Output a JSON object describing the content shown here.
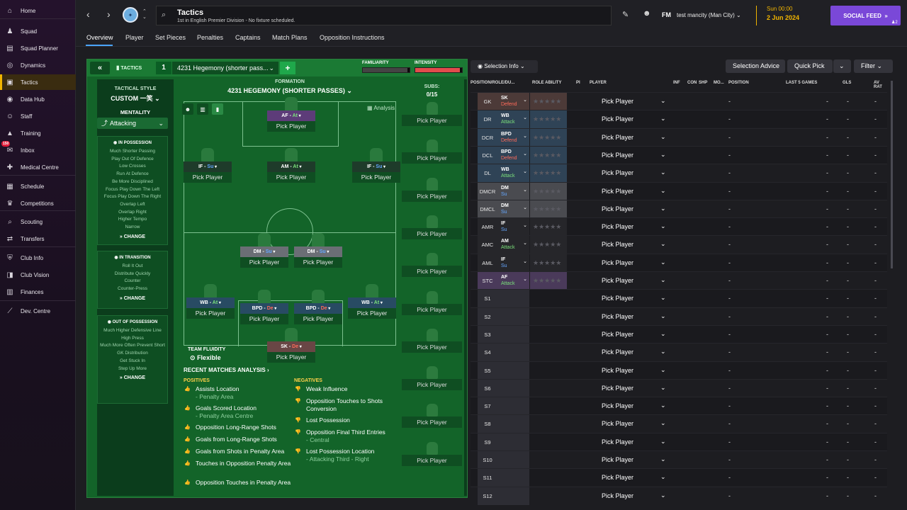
{
  "sidebar": {
    "items": [
      {
        "label": "Home",
        "icon": "home-icon",
        "glyph": "⌂"
      },
      {
        "label": "Squad",
        "icon": "squad-icon",
        "glyph": "♟"
      },
      {
        "label": "Squad Planner",
        "icon": "squad-planner-icon",
        "glyph": "▤"
      },
      {
        "label": "Dynamics",
        "icon": "dynamics-icon",
        "glyph": "◎"
      },
      {
        "label": "Tactics",
        "icon": "tactics-icon",
        "glyph": "▣",
        "active": true
      },
      {
        "label": "Data Hub",
        "icon": "data-hub-icon",
        "glyph": "◉"
      },
      {
        "label": "Staff",
        "icon": "staff-icon",
        "glyph": "☺"
      },
      {
        "label": "Training",
        "icon": "training-icon",
        "glyph": "▲"
      },
      {
        "label": "Inbox",
        "icon": "inbox-icon",
        "glyph": "✉",
        "badge": "150"
      },
      {
        "label": "Medical Centre",
        "icon": "medical-icon",
        "glyph": "✚"
      },
      {
        "label": "Schedule",
        "icon": "schedule-icon",
        "glyph": "▦"
      },
      {
        "label": "Competitions",
        "icon": "trophy-icon",
        "glyph": "♛"
      },
      {
        "label": "Scouting",
        "icon": "scouting-icon",
        "glyph": "⌕"
      },
      {
        "label": "Transfers",
        "icon": "transfers-icon",
        "glyph": "⇄"
      },
      {
        "label": "Club Info",
        "icon": "club-info-icon",
        "glyph": "⛨"
      },
      {
        "label": "Club Vision",
        "icon": "club-vision-icon",
        "glyph": "◨"
      },
      {
        "label": "Finances",
        "icon": "finances-icon",
        "glyph": "▥"
      },
      {
        "label": "Dev. Centre",
        "icon": "dev-centre-icon",
        "glyph": "⟋"
      }
    ]
  },
  "topbar": {
    "title": "Tactics",
    "subtitle": "1st in English Premier Division - No fixture scheduled.",
    "fm_label": "FM",
    "manager": "test mancity (Man City)",
    "time": "Sun 00:00",
    "date": "2 Jun 2024",
    "social_feed": "SOCIAL FEED",
    "social_count": "2"
  },
  "tabs": [
    "Overview",
    "Player",
    "Set Pieces",
    "Penalties",
    "Captains",
    "Match Plans",
    "Opposition Instructions"
  ],
  "tactics": {
    "header_label": "TACTICS",
    "slot_number": "1",
    "slot_name": "4231 Hegemony (shorter pass...",
    "familiarity_label": "FAMILIARITY",
    "familiarity_value": 0.95,
    "intensity_label": "INTENSITY",
    "intensity_value": 0.95,
    "tactical_style_label": "TACTICAL STYLE",
    "tactical_style_value": "CUSTOM 一笑",
    "mentality_label": "MENTALITY",
    "mentality_value": "Attacking",
    "formation_label": "FORMATION",
    "formation_name": "4231 HEGEMONY (SHORTER PASSES)",
    "analysis_label": "Analysis",
    "subs_label": "SUBS:",
    "subs_count": "0/15",
    "team_fluidity_label": "TEAM FLUIDITY",
    "team_fluidity_value": "Flexible",
    "in_possession": {
      "title": "IN POSSESSION",
      "items": [
        "Much Shorter Passing",
        "Play Out Of Defence",
        "Low Crosses",
        "Run At Defence",
        "Be More Disciplined",
        "Focus Play Down The Left",
        "Focus Play Down The Right",
        "Overlap Left",
        "Overlap Right",
        "Higher Tempo",
        "Narrow"
      ],
      "change": "CHANGE"
    },
    "in_transition": {
      "title": "IN TRANSITION",
      "items": [
        "Roll It Out",
        "Distribute Quickly",
        "Counter",
        "Counter-Press"
      ],
      "change": "CHANGE"
    },
    "out_of_possession": {
      "title": "OUT OF POSSESSION",
      "items": [
        "Much Higher Defensive Line",
        "High Press",
        "Much More Often Prevent Short GK Distribution",
        "Get Stuck In",
        "Step Up More"
      ],
      "change": "CHANGE"
    },
    "positions": [
      {
        "pos": "AF",
        "duty": "At",
        "cls": "fw",
        "player": "Pick Player"
      },
      {
        "pos": "IF",
        "duty": "Su",
        "cls": "mid",
        "player": "Pick Player"
      },
      {
        "pos": "AM",
        "duty": "At",
        "cls": "mid",
        "player": "Pick Player"
      },
      {
        "pos": "IF",
        "duty": "Su",
        "cls": "mid",
        "player": "Pick Player"
      },
      {
        "pos": "DM",
        "duty": "Su",
        "cls": "dm",
        "player": "Pick Player"
      },
      {
        "pos": "DM",
        "duty": "Su",
        "cls": "dm",
        "player": "Pick Player"
      },
      {
        "pos": "WB",
        "duty": "At",
        "cls": "df",
        "player": "Pick Player"
      },
      {
        "pos": "BPD",
        "duty": "De",
        "cls": "df",
        "player": "Pick Player"
      },
      {
        "pos": "BPD",
        "duty": "De",
        "cls": "df",
        "player": "Pick Player"
      },
      {
        "pos": "WB",
        "duty": "At",
        "cls": "df",
        "player": "Pick Player"
      },
      {
        "pos": "SK",
        "duty": "De",
        "cls": "gk",
        "player": "Pick Player"
      }
    ],
    "sub_slot_label": "Pick Player",
    "recent": {
      "title": "RECENT MATCHES ANALYSIS",
      "positives_label": "POSITIVES",
      "negatives_label": "NEGATIVES",
      "positives": [
        {
          "text": "Assists Location",
          "sub": "- Penalty Area"
        },
        {
          "text": "Goals Scored Location",
          "sub": "- Penalty Area Centre"
        },
        {
          "text": "Opposition Long-Range Shots",
          "sub": ""
        },
        {
          "text": "Goals from Long-Range Shots",
          "sub": ""
        },
        {
          "text": "Goals from Shots in Penalty Area",
          "sub": ""
        },
        {
          "text": "Touches in Opposition Penalty Area",
          "sub": ""
        },
        {
          "text": "Opposition Touches in Penalty Area",
          "sub": ""
        }
      ],
      "negatives": [
        {
          "text": "Weak Influence",
          "sub": ""
        },
        {
          "text": "Opposition Touches to Shots Conversion",
          "sub": ""
        },
        {
          "text": "Lost Possession",
          "sub": ""
        },
        {
          "text": "Opposition Final Third Entries",
          "sub": "- Central"
        },
        {
          "text": "Lost Possession Location",
          "sub": "- Attacking Third - Right"
        }
      ]
    }
  },
  "right": {
    "selection_info": "Selection Info",
    "selection_advice": "Selection Advice",
    "quick_pick": "Quick Pick",
    "filter": "Filter",
    "columns": [
      "POSITION/ROLE/DU...",
      "ROLE ABILITY",
      "PI",
      "PLAYER",
      "INF",
      "CON",
      "SHP",
      "MO...",
      "POSITION",
      "LAST 5 GAMES",
      "GLS",
      "AV RAT"
    ],
    "rows": [
      {
        "pos": "GK",
        "role": "SK",
        "duty": "Defend",
        "dcls": "de",
        "bg": "#4c3a38"
      },
      {
        "pos": "DR",
        "role": "WB",
        "duty": "Attack",
        "dcls": "at",
        "bg": "#2f4356"
      },
      {
        "pos": "DCR",
        "role": "BPD",
        "duty": "Defend",
        "dcls": "de",
        "bg": "#2f4356"
      },
      {
        "pos": "DCL",
        "role": "BPD",
        "duty": "Defend",
        "dcls": "de",
        "bg": "#2f4356"
      },
      {
        "pos": "DL",
        "role": "WB",
        "duty": "Attack",
        "dcls": "at",
        "bg": "#2f4356"
      },
      {
        "pos": "DMCR",
        "role": "DM",
        "duty": "Su",
        "dcls": "su",
        "bg": "#4a4b50"
      },
      {
        "pos": "DMCL",
        "role": "DM",
        "duty": "Su",
        "dcls": "su",
        "bg": "#4a4b50"
      },
      {
        "pos": "AMR",
        "role": "IF",
        "duty": "Su",
        "dcls": "su",
        "bg": "#26262a"
      },
      {
        "pos": "AMC",
        "role": "AM",
        "duty": "Attack",
        "dcls": "at",
        "bg": "#26262a"
      },
      {
        "pos": "AML",
        "role": "IF",
        "duty": "Su",
        "dcls": "su",
        "bg": "#26262a"
      },
      {
        "pos": "STC",
        "role": "AF",
        "duty": "Attack",
        "dcls": "at",
        "bg": "#4a3a5a"
      },
      {
        "pos": "S1",
        "role": "",
        "duty": "",
        "dcls": "",
        "bg": ""
      },
      {
        "pos": "S2",
        "role": "",
        "duty": "",
        "dcls": "",
        "bg": ""
      },
      {
        "pos": "S3",
        "role": "",
        "duty": "",
        "dcls": "",
        "bg": ""
      },
      {
        "pos": "S4",
        "role": "",
        "duty": "",
        "dcls": "",
        "bg": ""
      },
      {
        "pos": "S5",
        "role": "",
        "duty": "",
        "dcls": "",
        "bg": ""
      },
      {
        "pos": "S6",
        "role": "",
        "duty": "",
        "dcls": "",
        "bg": ""
      },
      {
        "pos": "S7",
        "role": "",
        "duty": "",
        "dcls": "",
        "bg": ""
      },
      {
        "pos": "S8",
        "role": "",
        "duty": "",
        "dcls": "",
        "bg": ""
      },
      {
        "pos": "S9",
        "role": "",
        "duty": "",
        "dcls": "",
        "bg": ""
      },
      {
        "pos": "S10",
        "role": "",
        "duty": "",
        "dcls": "",
        "bg": ""
      },
      {
        "pos": "S11",
        "role": "",
        "duty": "",
        "dcls": "",
        "bg": ""
      },
      {
        "pos": "S12",
        "role": "",
        "duty": "",
        "dcls": "",
        "bg": ""
      }
    ],
    "player_placeholder": "Pick Player",
    "dash": "-"
  },
  "colors": {
    "accent": "#f0b400",
    "social": "#7a48d8",
    "pitch": "#136429",
    "tab_underline": "#4aa4ff"
  }
}
